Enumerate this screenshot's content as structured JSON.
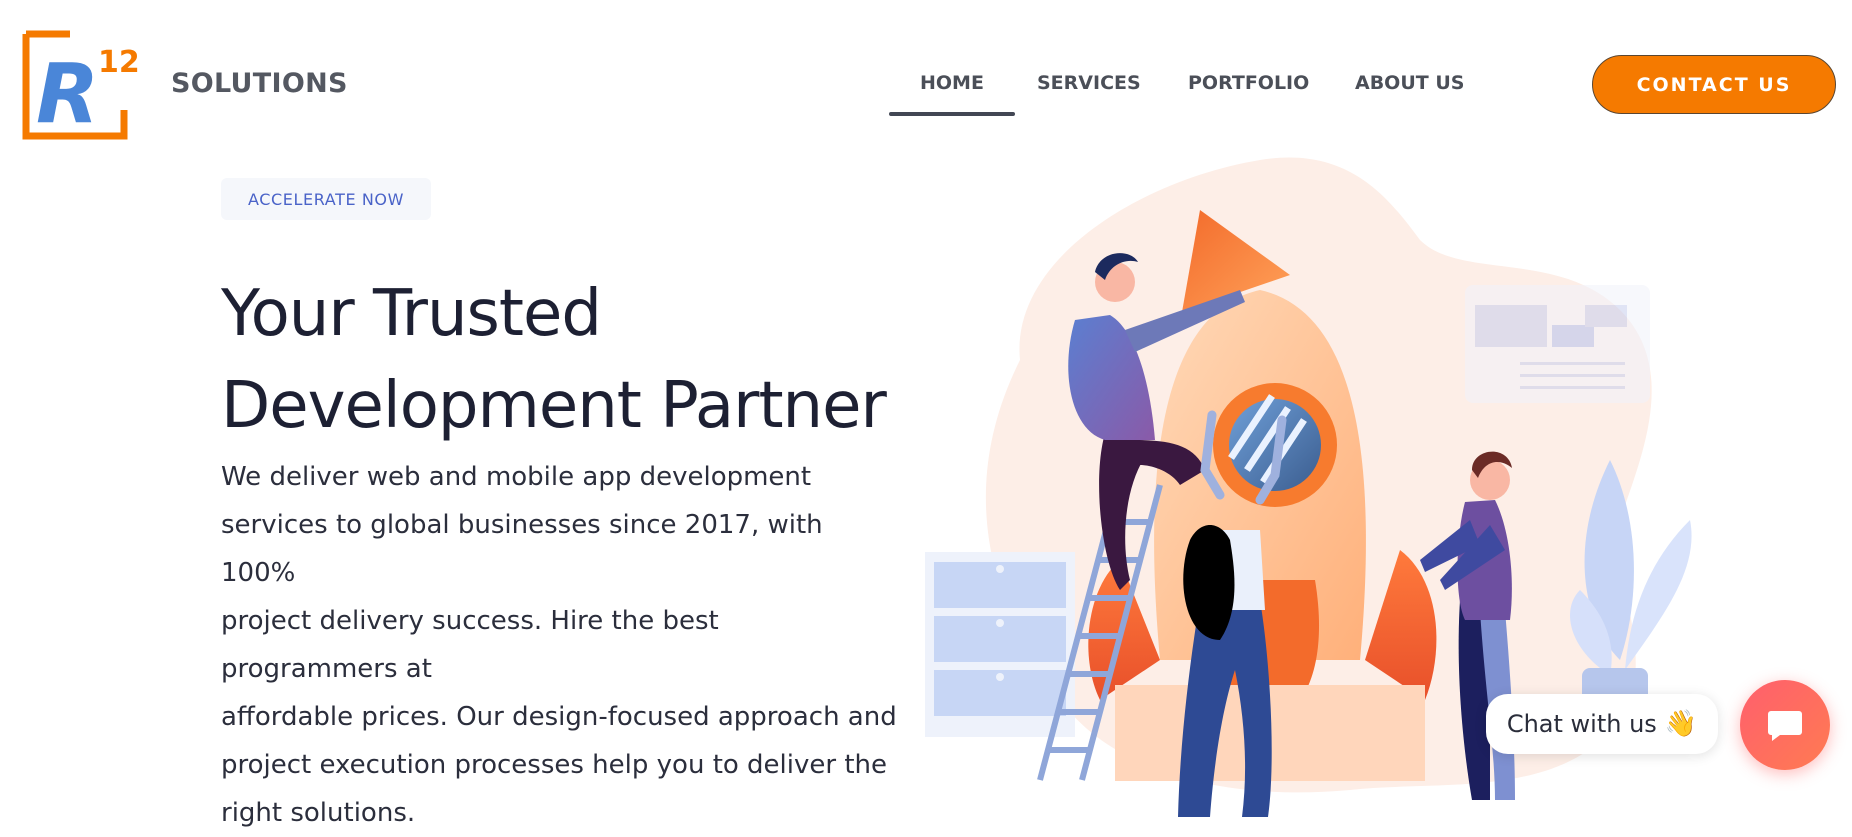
{
  "header": {
    "logo": {
      "letter": "R",
      "number": "12"
    },
    "brand_name": "SOLUTIONS",
    "nav": [
      {
        "label": "HOME",
        "active": true
      },
      {
        "label": "SERVICES",
        "active": false
      },
      {
        "label": "PORTFOLIO",
        "active": false
      },
      {
        "label": "ABOUT US",
        "active": false
      }
    ],
    "contact_button": "CONTACT US"
  },
  "hero": {
    "badge": "ACCELERATE NOW",
    "headline_line1": "Your Trusted",
    "headline_line2": "Development Partner",
    "description_lines": [
      "We deliver web and mobile app development",
      "services to global businesses since 2017, with 100%",
      "project delivery success. Hire the best programmers at",
      "affordable prices. Our design-focused approach and",
      "project execution processes help you to deliver the",
      "right solutions."
    ]
  },
  "chat": {
    "bubble_text": "Chat with us",
    "wave_emoji": "👋",
    "launcher_icon": "chat-icon"
  },
  "colors": {
    "accent": "#f57a00",
    "logo_blue": "#4a86d8",
    "nav_text": "#4b4f58",
    "badge_text": "#4a63c8",
    "chat_launcher": "#ff6a5c"
  }
}
